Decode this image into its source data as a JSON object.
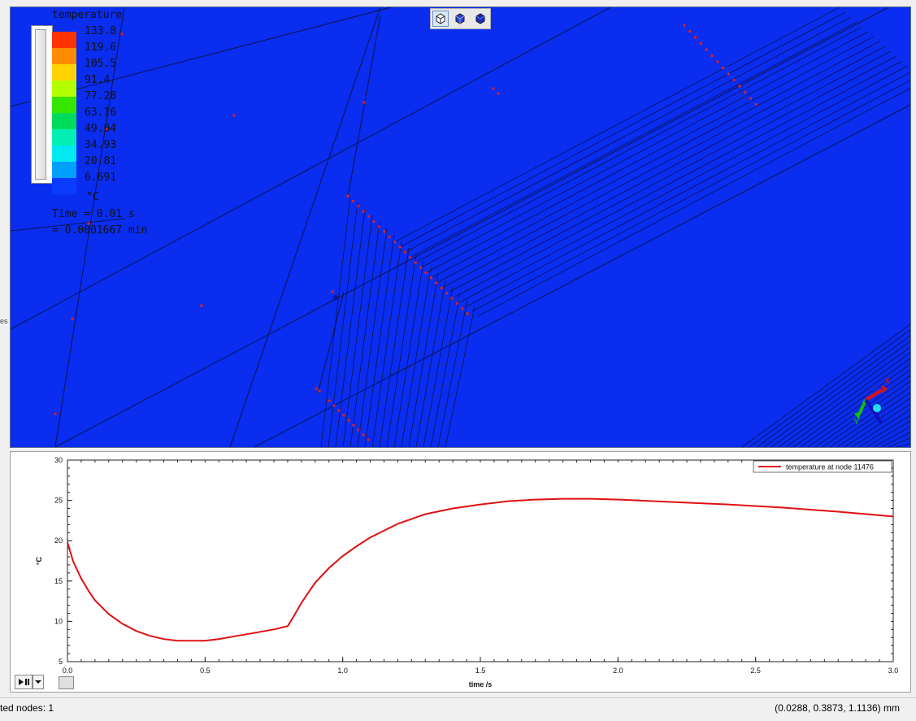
{
  "viewport": {
    "background": "#0a2df0",
    "toolbar_icons": [
      "iso-view-icon",
      "front-view-icon",
      "solid-view-icon"
    ]
  },
  "legend": {
    "title": "temperature",
    "unit": "°C",
    "levels": [
      {
        "label": "133.8",
        "color": "#ff3300"
      },
      {
        "label": "119.6",
        "color": "#ff8c00"
      },
      {
        "label": "105.5",
        "color": "#ffd200"
      },
      {
        "label": "91.4",
        "color": "#b4ff00"
      },
      {
        "label": "77.28",
        "color": "#36e600"
      },
      {
        "label": "63.16",
        "color": "#00dc5a"
      },
      {
        "label": "49.04",
        "color": "#00f0b4"
      },
      {
        "label": "34.93",
        "color": "#00e8f0"
      },
      {
        "label": "20.81",
        "color": "#00a0ff"
      },
      {
        "label": "6.691",
        "color": "#0a3cff"
      }
    ],
    "time_line1": "Time = 0.01 s",
    "time_line2": "= 0.0001667 min"
  },
  "axes_triad": {
    "x_label": "X",
    "y_label": "Y"
  },
  "chart_data": {
    "type": "line",
    "xlabel": "time /s",
    "ylabel": "°C",
    "xlim": [
      0,
      3
    ],
    "ylim": [
      5,
      30
    ],
    "x_ticks": [
      "0.0",
      "0.5",
      "1.0",
      "1.5",
      "2.0",
      "2.5",
      "3.0"
    ],
    "y_ticks": [
      "5",
      "10",
      "15",
      "20",
      "25",
      "30"
    ],
    "grid": false,
    "legend_position": "top-right",
    "series": [
      {
        "name": "temperature at node 11476",
        "color": "#e01010",
        "x": [
          0.0,
          0.02,
          0.05,
          0.08,
          0.1,
          0.15,
          0.2,
          0.25,
          0.3,
          0.35,
          0.4,
          0.45,
          0.5,
          0.55,
          0.6,
          0.65,
          0.7,
          0.75,
          0.8,
          0.82,
          0.85,
          0.88,
          0.9,
          0.95,
          1.0,
          1.05,
          1.1,
          1.2,
          1.3,
          1.4,
          1.5,
          1.6,
          1.7,
          1.8,
          1.9,
          2.0,
          2.2,
          2.4,
          2.6,
          2.8,
          3.0
        ],
        "values": [
          19.8,
          17.5,
          15.3,
          13.6,
          12.6,
          10.9,
          9.7,
          8.8,
          8.2,
          7.8,
          7.6,
          7.6,
          7.6,
          7.8,
          8.1,
          8.4,
          8.7,
          9.0,
          9.4,
          10.5,
          12.3,
          13.8,
          14.8,
          16.6,
          18.1,
          19.3,
          20.4,
          22.1,
          23.3,
          24.0,
          24.5,
          24.9,
          25.1,
          25.2,
          25.2,
          25.1,
          24.8,
          24.5,
          24.1,
          23.6,
          23.0
        ]
      }
    ]
  },
  "status": {
    "left": "ted nodes: 1",
    "right": "(0.0288, 0.3873, 1.1136) mm",
    "left_edge": "es"
  }
}
